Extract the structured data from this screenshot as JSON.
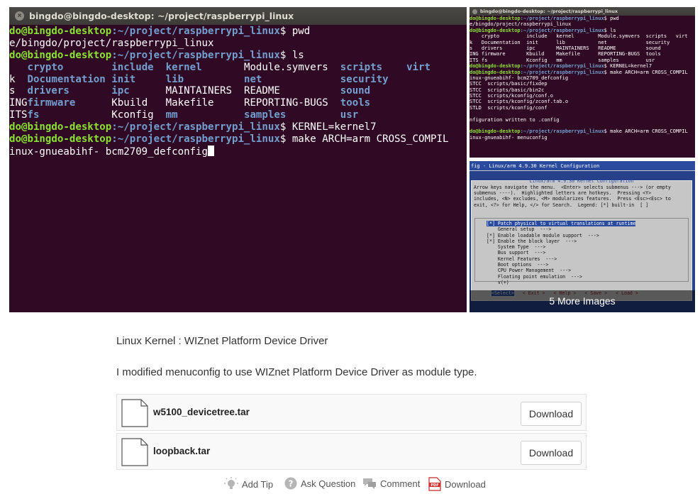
{
  "gallery": {
    "main": {
      "window_title": "bingdo@bingdo-desktop: ~/project/raspberrypi_linux",
      "lines": [
        {
          "user": "do@bingdo-desktop",
          "path": ":~/project/raspberrypi_linux",
          "cmd": "$ pwd"
        },
        {
          "text": "e/bingdo/project/raspberrypi_linux"
        },
        {
          "user": "do@bingdo-desktop",
          "path": ":~/project/raspberrypi_linux",
          "cmd": "$ ls"
        },
        {
          "ls": [
            "  ",
            "crypto",
            "include",
            "kernel",
            "Module.symvers",
            "scripts",
            "virt"
          ]
        },
        {
          "ls": [
            "k",
            "Documentation",
            "init",
            "lib",
            "net",
            "security",
            ""
          ]
        },
        {
          "ls": [
            "s",
            "drivers",
            "ipc",
            "MAINTAINERS",
            "README",
            "sound",
            ""
          ]
        },
        {
          "ls": [
            "ING",
            "firmware",
            "Kbuild",
            "Makefile",
            "REPORTING-BUGS",
            "tools",
            ""
          ]
        },
        {
          "ls": [
            "ITS",
            "fs",
            "Kconfig",
            "mm",
            "samples",
            "usr",
            ""
          ]
        },
        {
          "user": "do@bingdo-desktop",
          "path": ":~/project/raspberrypi_linux",
          "cmd": "$ KERNEL=kernel7"
        },
        {
          "user": "do@bingdo-desktop",
          "path": ":~/project/raspberrypi_linux",
          "cmd": "$ make ARCH=arm CROSS_COMPIL"
        },
        {
          "text": "inux-gnueabihf- bcm2709_defconfig",
          "cursor": true
        }
      ]
    },
    "thumb1": {
      "window_title": "bingdo@bingdo-desktop: ~/project/raspberrypi_linux",
      "lines": [
        "do@bingdo-desktop:~/project/raspberrypi_linux$ pwd",
        "e/bingdo/project/raspberrypi_linux",
        "do@bingdo-desktop:~/project/raspberrypi_linux$ ls",
        "    crypto         include   kernel        Module.symvers  scripts   virt",
        "k   Documentation  init      lib           net             security",
        "s   drivers        ipc       MAINTAINERS   README          sound",
        "ING firmware       Kbuild    Makefile      REPORTING-BUGS  tools",
        "ITS fs             Kconfig   mm            samples         usr",
        "do@bingdo-desktop:~/project/raspberrypi_linux$ KERNEL=kernel7",
        "do@bingdo-desktop:~/project/raspberrypi_linux$ make ARCH=arm CROSS_COMPIL",
        "inux-gnueabihf- bcm2709_defconfig",
        "STCC  scripts/basic/fixdep",
        "STCC  scripts/basic/bin2c",
        "STCC  scripts/kconfig/conf.o",
        "STCC  scripts/kconfig/zconf.tab.o",
        "STLD  scripts/kconfig/conf",
        "",
        "nfiguration written to .config",
        "",
        "do@bingdo-desktop:~/project/raspberrypi_linux$ make ARCH=arm CROSS_COMPIL",
        "inux-gnueabihf- menuconfig"
      ]
    },
    "thumb2": {
      "header": "fig - Linux/arm 4.9.30 Kernel Configuration",
      "box_title": "Linux/arm 4.9.30 Kernel Configuration",
      "help_lines": [
        "Arrow keys navigate the menu.  <Enter> selects submenus ---> (or empty",
        "submenus ----).  Highlighted letters are hotkeys.  Pressing <Y>",
        "includes, <N> excludes, <M> modularizes features.  Press <Esc><Esc> to",
        "exit, <?> for Help, </> for Search.  Legend: [*] built-in  [ ]"
      ],
      "items": [
        {
          "text": "[*] Patch physical to virtual translations at runtime",
          "selected": true
        },
        {
          "text": "    General setup  --->"
        },
        {
          "text": "[*] Enable loadable module support  --->"
        },
        {
          "text": "[*] Enable the block layer  --->"
        },
        {
          "text": "    System Type  --->"
        },
        {
          "text": "    Bus support  --->"
        },
        {
          "text": "    Kernel Features  --->"
        },
        {
          "text": "    Boot options  --->"
        },
        {
          "text": "    CPU Power Management  --->"
        },
        {
          "text": "    Floating point emulation  --->"
        },
        {
          "text": "    v(+)"
        }
      ],
      "buttons": [
        "<Select>",
        "< Exit >",
        "< Help >",
        "< Save >",
        "< Load >"
      ],
      "more_label": "5 More Images"
    }
  },
  "caption": "Linux Kernel : WIZnet Platform Device Driver",
  "description": "I modified menuconfig to use WIZnet Platform Device Driver as module type.",
  "files": [
    {
      "name": "w5100_devicetree.tar",
      "button": "Download"
    },
    {
      "name": "loopback.tar",
      "button": "Download"
    }
  ],
  "actions": {
    "add_tip": "Add Tip",
    "ask_question": "Ask Question",
    "comment": "Comment",
    "download": "Download",
    "pdf_badge": "PDF"
  }
}
